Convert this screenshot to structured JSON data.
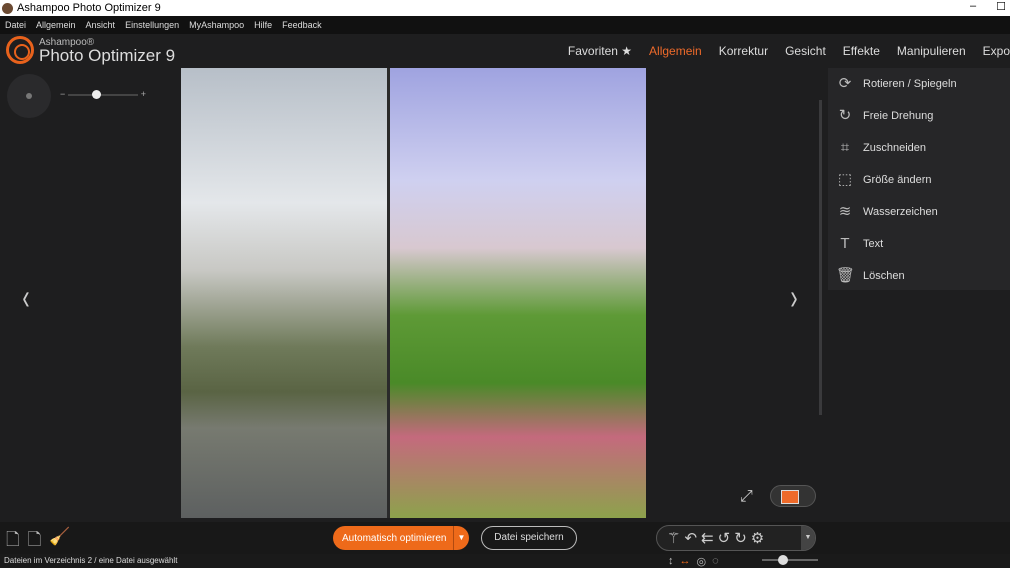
{
  "window": {
    "title": "Ashampoo Photo Optimizer 9",
    "minimize": "–",
    "maximize": "☐"
  },
  "menu": [
    "Datei",
    "Allgemein",
    "Ansicht",
    "Einstellungen",
    "MyAshampoo",
    "Hilfe",
    "Feedback"
  ],
  "brand": {
    "company": "Ashampoo®",
    "product": "Photo Optimizer 9"
  },
  "tabs": [
    "Favoriten ★",
    "Allgemein",
    "Korrektur",
    "Gesicht",
    "Effekte",
    "Manipulieren",
    "Expo"
  ],
  "active_tab": "Allgemein",
  "zoom": {
    "minus": "−",
    "plus": "+",
    "level_fraction": 0.45
  },
  "side_panel": [
    {
      "icon": "rotate-icon",
      "glyph": "⟳",
      "label": "Rotieren / Spiegeln"
    },
    {
      "icon": "free-rotate-icon",
      "glyph": "↻",
      "label": "Freie Drehung"
    },
    {
      "icon": "crop-icon",
      "glyph": "⌗",
      "label": "Zuschneiden"
    },
    {
      "icon": "resize-icon",
      "glyph": "⬚",
      "label": "Größe ändern"
    },
    {
      "icon": "watermark-icon",
      "glyph": "≋",
      "label": "Wasserzeichen"
    },
    {
      "icon": "text-icon",
      "glyph": "T",
      "label": "Text"
    },
    {
      "icon": "delete-icon",
      "glyph": "🗑",
      "label": "Löschen"
    }
  ],
  "nav": {
    "prev": "‹",
    "next": "›"
  },
  "bottom": {
    "auto_label": "Automatisch optimieren",
    "save_label": "Datei speichern"
  },
  "status": "Dateien im Verzeichnis 2 / eine Datei ausgewählt",
  "accent": "#ee6a1a"
}
